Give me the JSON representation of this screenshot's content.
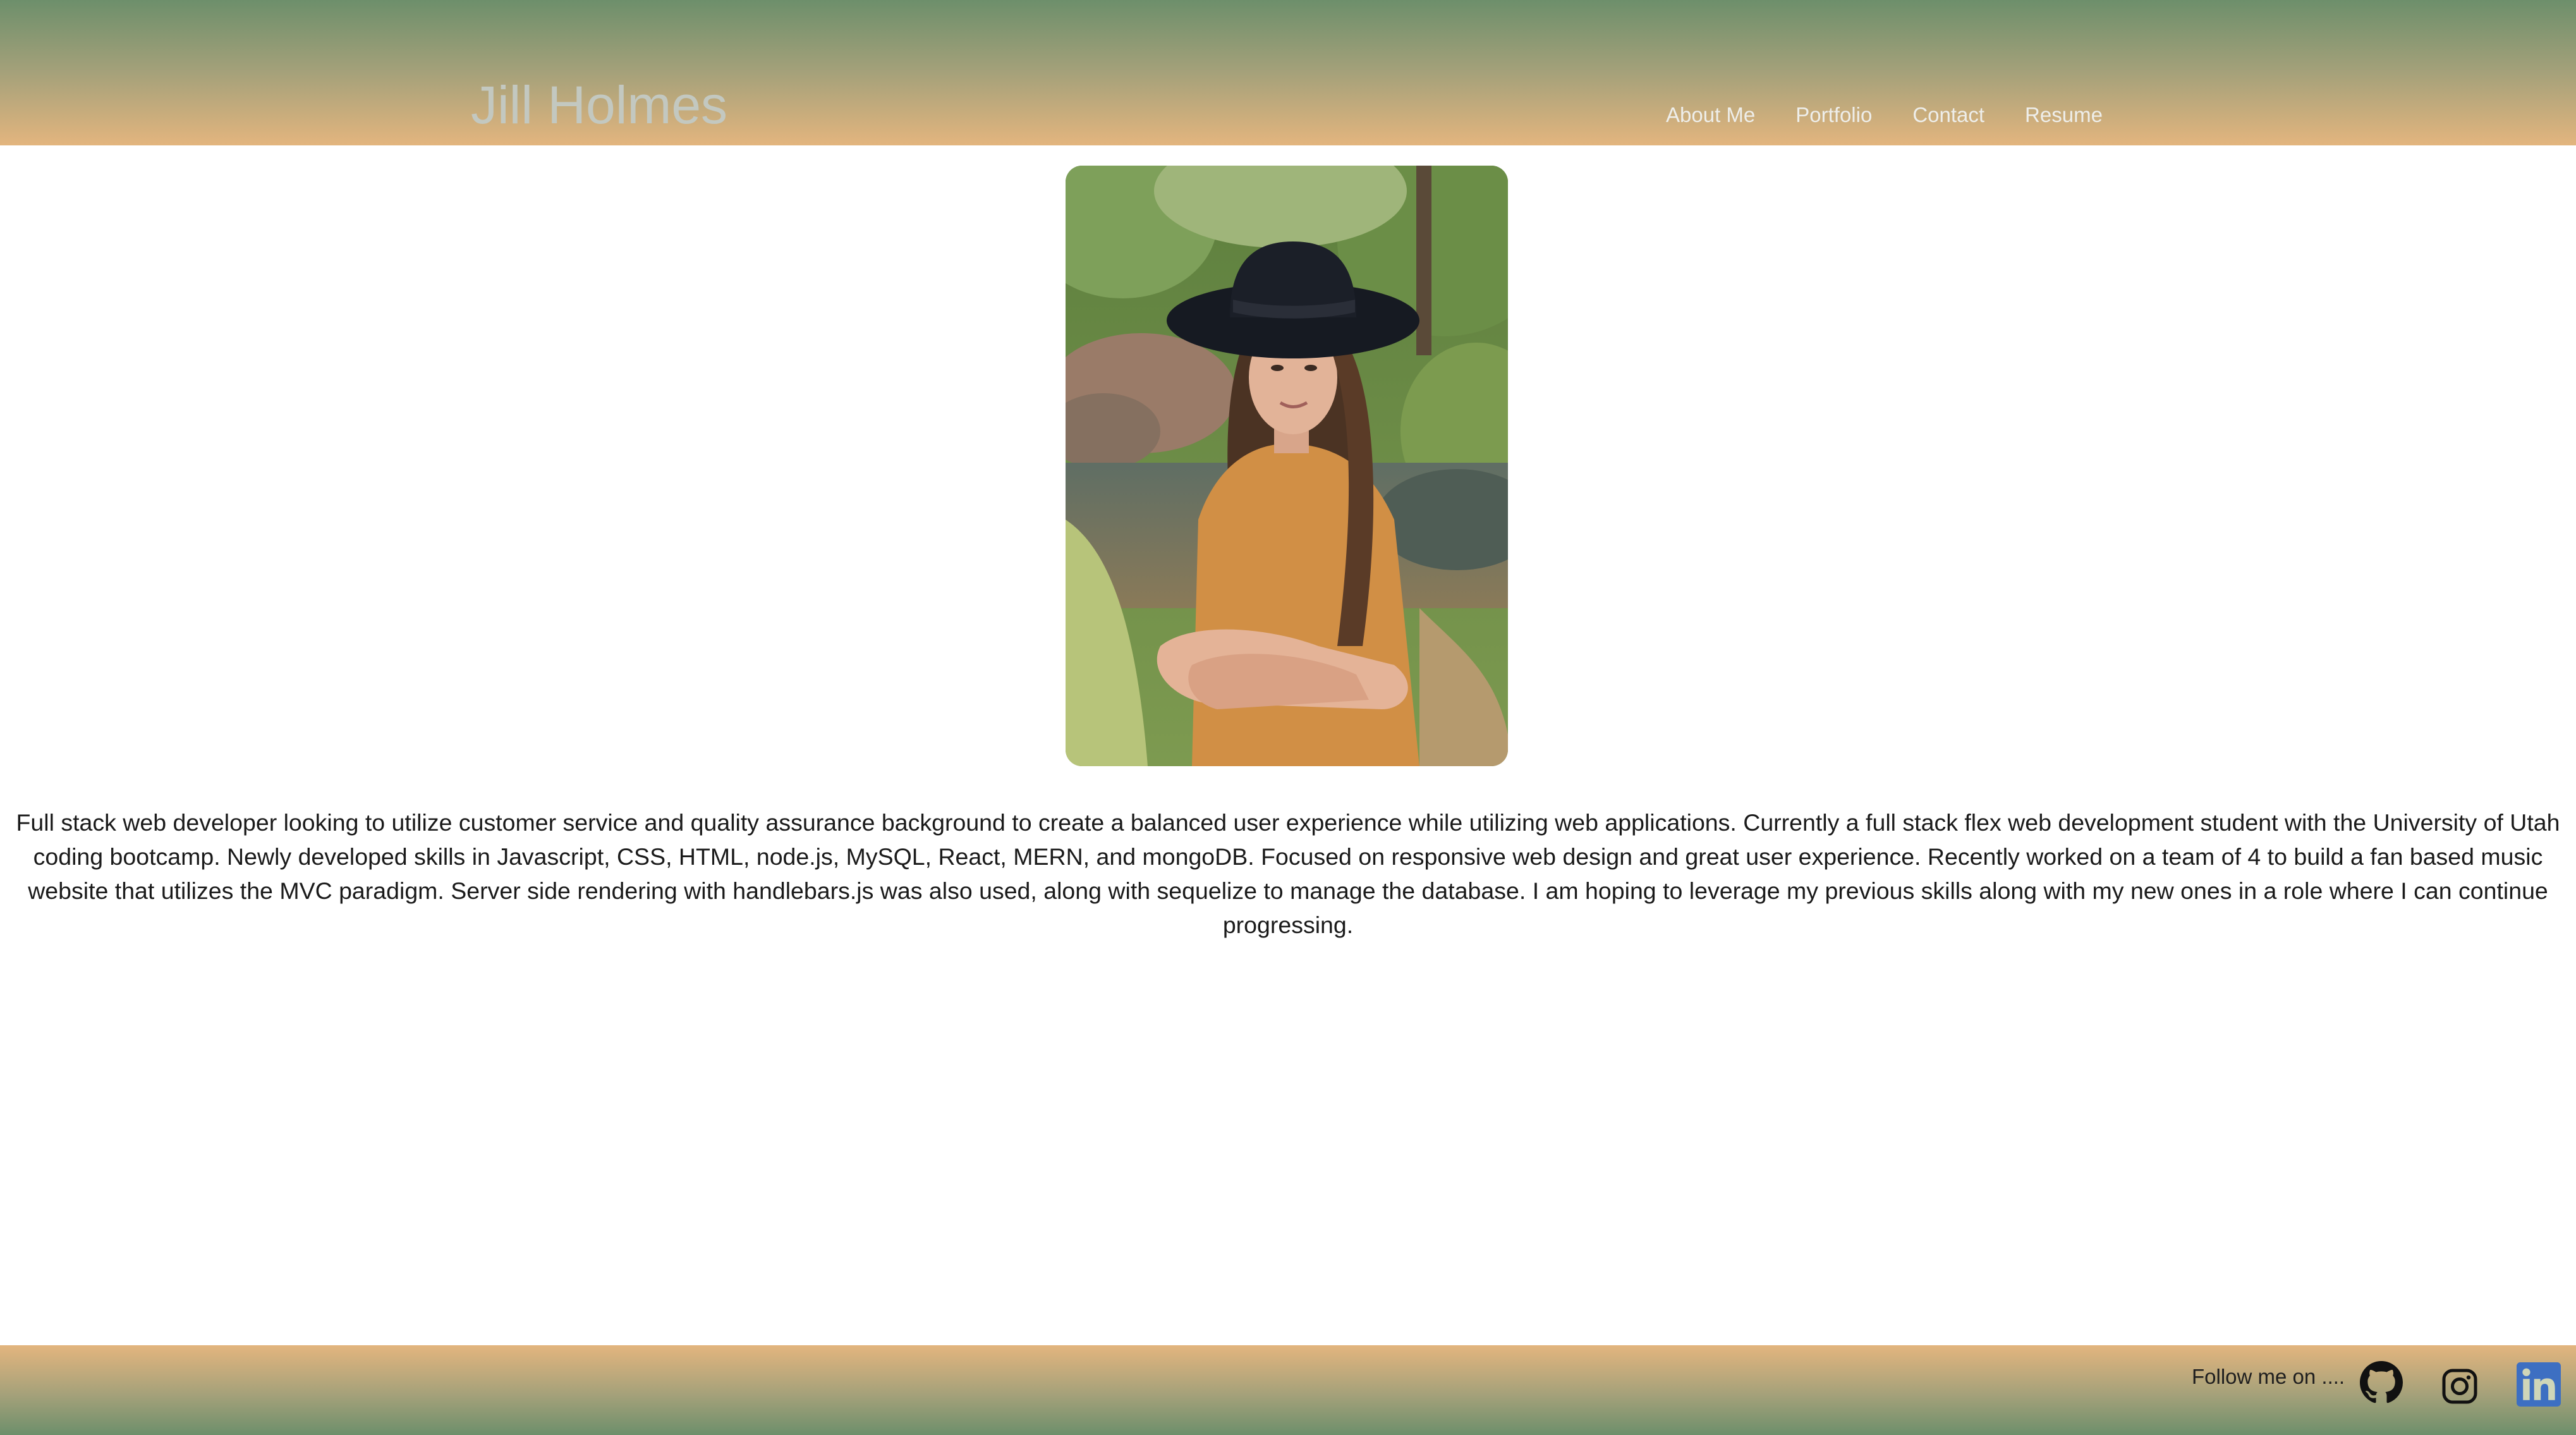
{
  "header": {
    "site_title": "Jill Holmes",
    "nav": [
      {
        "label": "About Me"
      },
      {
        "label": "Portfolio"
      },
      {
        "label": "Contact"
      },
      {
        "label": "Resume"
      }
    ]
  },
  "main": {
    "portrait_icon": "profile-photo",
    "bio": "Full stack web developer looking to utilize customer service and quality assurance background to create a balanced user experience while utilizing web applications. Currently a full stack flex web development student with the University of Utah coding bootcamp. Newly developed skills in Javascript, CSS, HTML, node.js, MySQL, React, MERN, and mongoDB. Focused on responsive web design and great user experience. Recently worked on a team of 4 to build a fan based music website that utilizes the MVC paradigm. Server side rendering with handlebars.js was also used, along with sequelize to manage the database. I am hoping to leverage my previous skills along with my new ones in a role where I can continue progressing."
  },
  "footer": {
    "follow_text": "Follow me on ....",
    "social": [
      {
        "icon": "github-icon"
      },
      {
        "icon": "instagram-icon"
      },
      {
        "icon": "linkedin-icon"
      }
    ]
  },
  "colors": {
    "header_top": "#6d8f6b",
    "header_bottom": "#e3b57e",
    "linkedin_blue": "#2867b2"
  }
}
